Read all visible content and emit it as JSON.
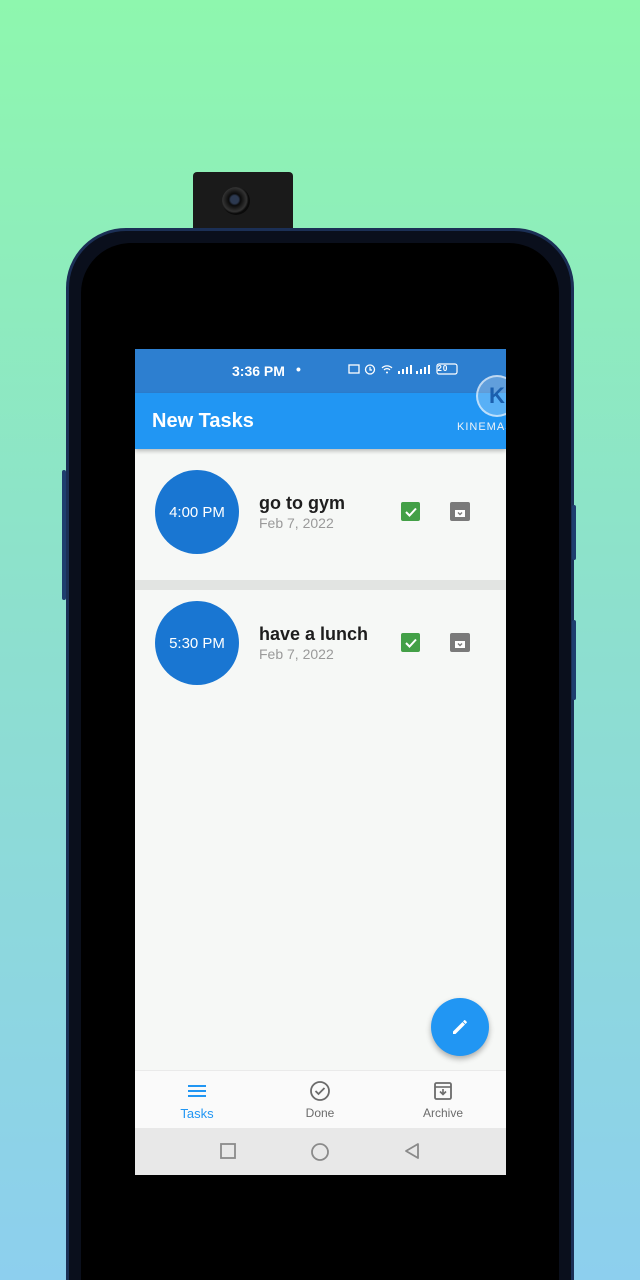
{
  "status_bar": {
    "time": "3:36 PM",
    "dot": "•",
    "icons": "⧉ ⏰ ≋ .ıl.ıl ⁱ⁴ ⁎ ▭20",
    "battery": "20"
  },
  "app_bar": {
    "title": "New Tasks"
  },
  "watermark": {
    "logo_letter": "K",
    "text": "KINEMASTER"
  },
  "tasks": [
    {
      "time": "4:00 PM",
      "title": "go to gym",
      "date": "Feb 7, 2022"
    },
    {
      "time": "5:30 PM",
      "title": "have a lunch",
      "date": "Feb 7, 2022"
    }
  ],
  "bottom_nav": {
    "items": [
      {
        "label": "Tasks",
        "icon": "menu-icon",
        "active": true
      },
      {
        "label": "Done",
        "icon": "check-circle-icon",
        "active": false
      },
      {
        "label": "Archive",
        "icon": "archive-icon",
        "active": false
      }
    ]
  },
  "colors": {
    "primary": "#2196f3",
    "circle": "#1976d2",
    "done": "#43a047",
    "archive": "#7a7a7a"
  }
}
